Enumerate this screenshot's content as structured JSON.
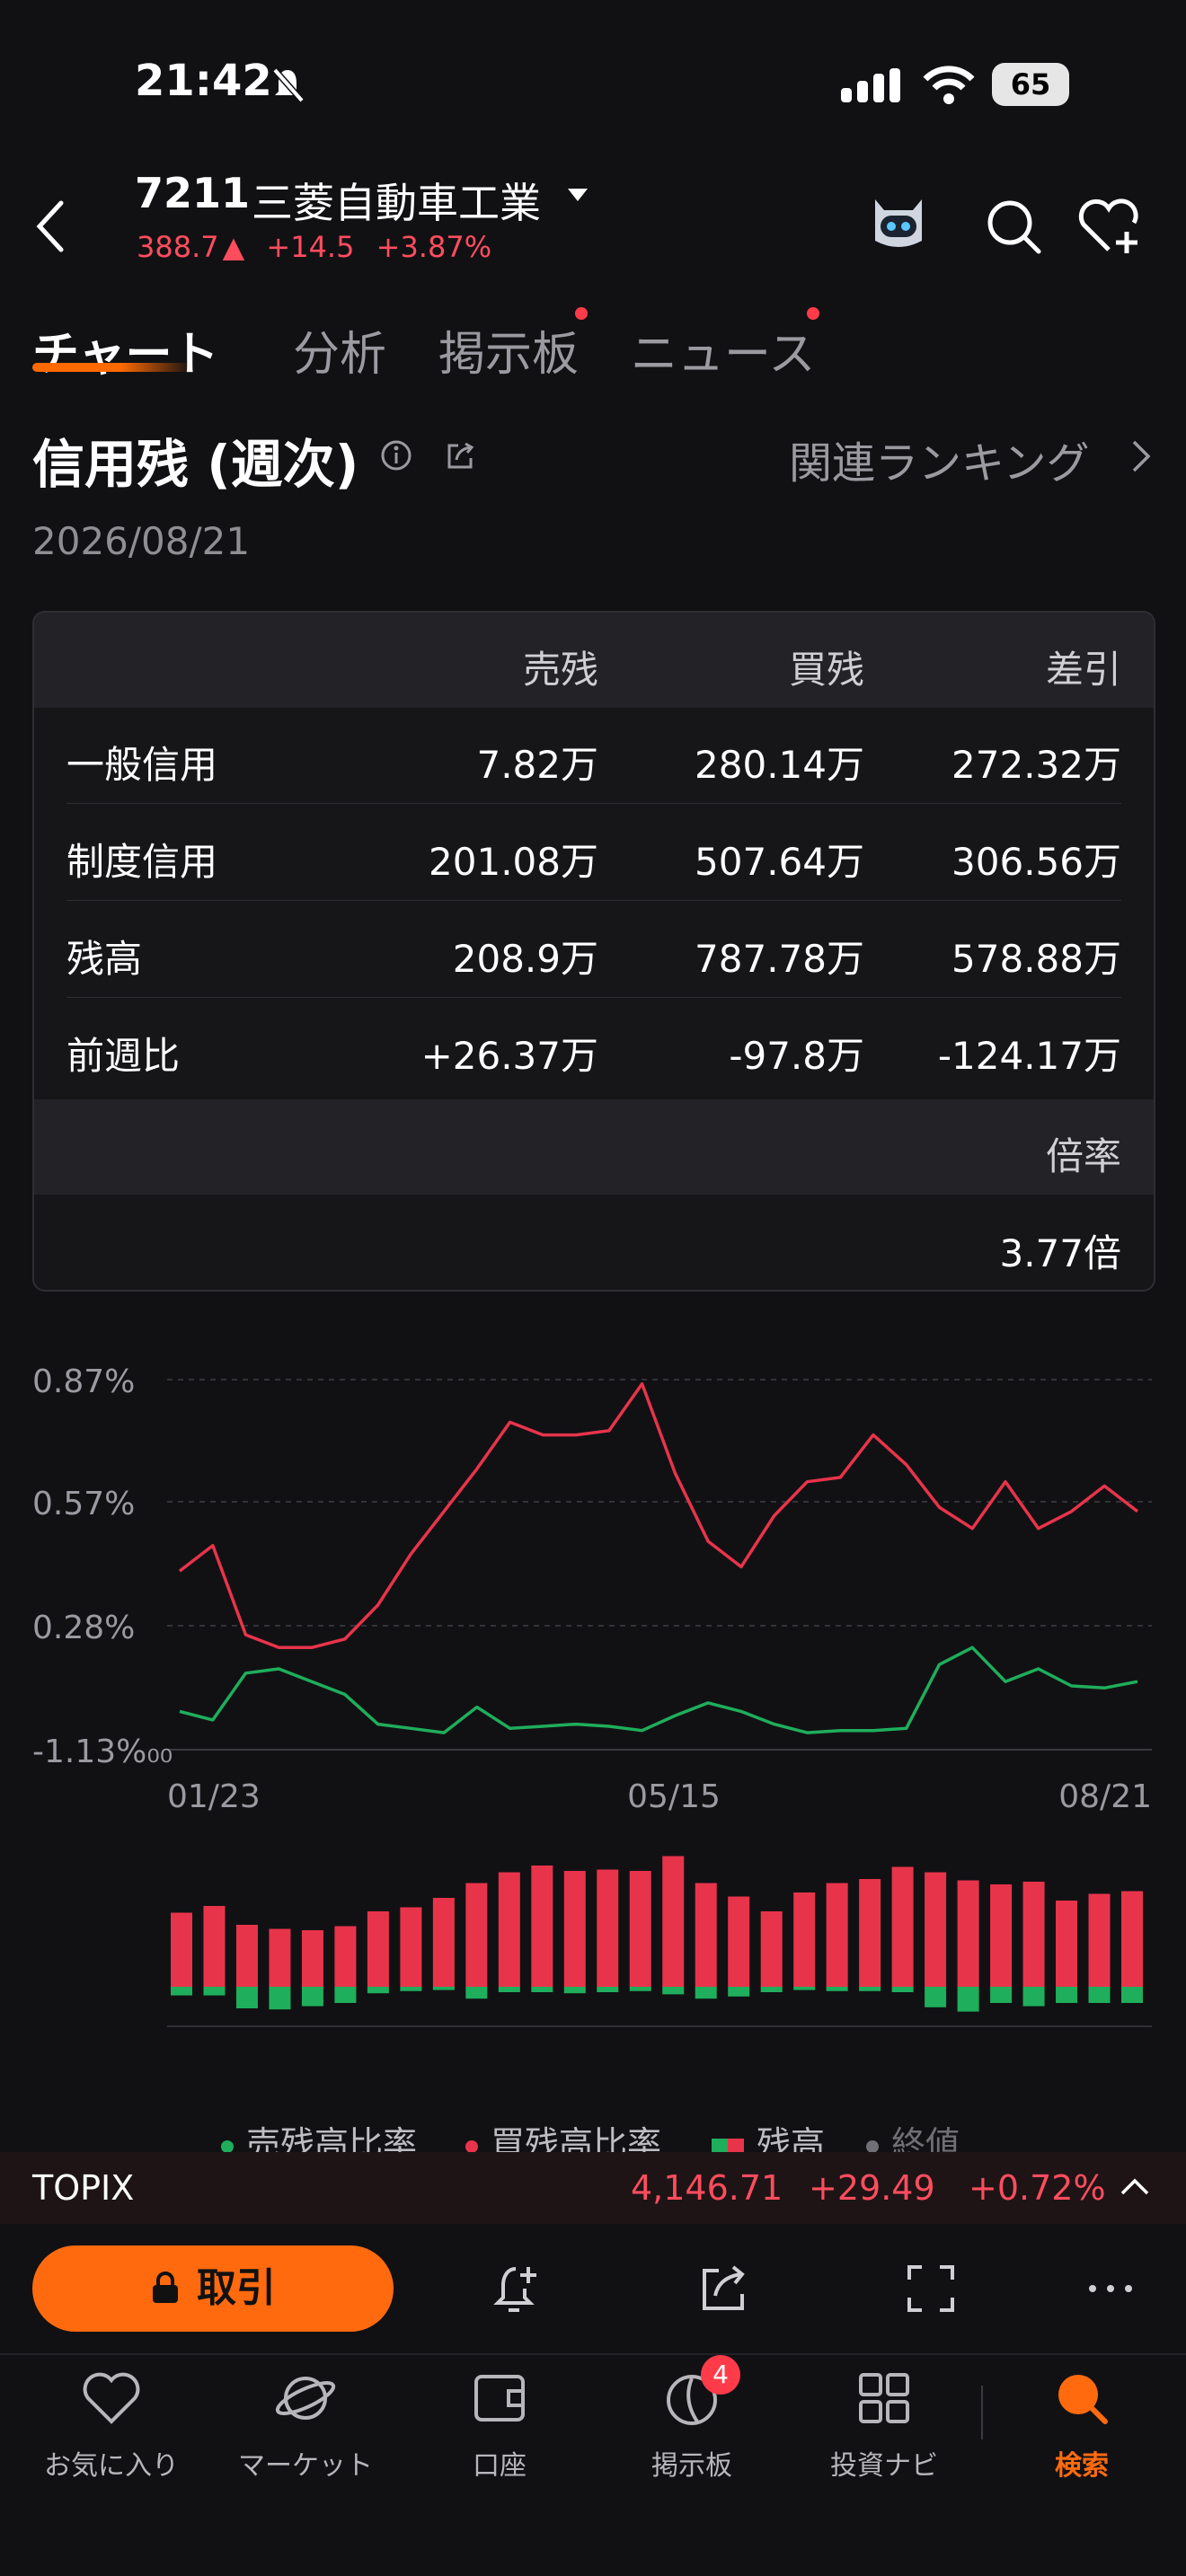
{
  "status": {
    "time": "21:42",
    "battery": "65"
  },
  "header": {
    "code": "7211",
    "name": "三菱自動車工業",
    "price": "388.7",
    "change": "+14.5",
    "change_pct": "+3.87%"
  },
  "tabs": [
    {
      "label": "チャート",
      "active": true
    },
    {
      "label": "分析"
    },
    {
      "label": "掲示板",
      "dot": true
    },
    {
      "label": "ニュース",
      "dot": true
    }
  ],
  "section": {
    "title": "信用残 (週次)",
    "ranking_link": "関連ランキング",
    "date": "2026/08/21"
  },
  "table": {
    "headers": [
      "売残",
      "買残",
      "差引"
    ],
    "rows": [
      {
        "label": "一般信用",
        "sell": "7.82万",
        "buy": "280.14万",
        "diff": "272.32万"
      },
      {
        "label": "制度信用",
        "sell": "201.08万",
        "buy": "507.64万",
        "diff": "306.56万"
      },
      {
        "label": "残高",
        "sell": "208.9万",
        "buy": "787.78万",
        "diff": "578.88万"
      },
      {
        "label": "前週比",
        "sell": "+26.37万",
        "buy": "-97.8万",
        "diff": "-124.17万"
      }
    ],
    "ratio_header": "倍率",
    "ratio_value": "3.77倍"
  },
  "chart_data": {
    "type": "line",
    "y_tick_labels": [
      "0.87%",
      "0.57%",
      "0.28%",
      "-1.13%₀₀"
    ],
    "x_tick_labels": [
      "01/23",
      "05/15",
      "08/21"
    ],
    "series": [
      {
        "name": "買残高比率",
        "color": "#e8344a",
        "values": [
          0.42,
          0.48,
          0.27,
          0.24,
          0.24,
          0.26,
          0.34,
          0.46,
          0.56,
          0.66,
          0.77,
          0.74,
          0.74,
          0.75,
          0.86,
          0.65,
          0.49,
          0.43,
          0.55,
          0.63,
          0.64,
          0.74,
          0.67,
          0.57,
          0.52,
          0.63,
          0.52,
          0.56,
          0.62,
          0.56
        ]
      },
      {
        "name": "売残高比率",
        "color": "#1fae5b",
        "values": [
          0.09,
          0.07,
          0.18,
          0.19,
          0.16,
          0.13,
          0.06,
          0.05,
          0.04,
          0.1,
          0.05,
          0.055,
          0.06,
          0.055,
          0.045,
          0.08,
          0.11,
          0.09,
          0.06,
          0.04,
          0.045,
          0.045,
          0.05,
          0.2,
          0.24,
          0.16,
          0.19,
          0.15,
          0.145,
          0.16
        ]
      }
    ],
    "bars": {
      "buy": [
        0.55,
        0.6,
        0.46,
        0.43,
        0.42,
        0.45,
        0.56,
        0.59,
        0.66,
        0.77,
        0.85,
        0.9,
        0.86,
        0.87,
        0.86,
        0.97,
        0.77,
        0.67,
        0.56,
        0.7,
        0.77,
        0.8,
        0.89,
        0.85,
        0.79,
        0.76,
        0.78,
        0.64,
        0.69,
        0.71
      ],
      "sell": [
        0.08,
        0.08,
        0.2,
        0.21,
        0.18,
        0.15,
        0.06,
        0.04,
        0.03,
        0.11,
        0.05,
        0.05,
        0.06,
        0.05,
        0.04,
        0.07,
        0.11,
        0.09,
        0.05,
        0.03,
        0.04,
        0.04,
        0.05,
        0.19,
        0.23,
        0.15,
        0.18,
        0.15,
        0.15,
        0.15
      ]
    },
    "legend": [
      {
        "label": "売残高比率",
        "color": "#1fae5b"
      },
      {
        "label": "買残高比率",
        "color": "#e8344a"
      },
      {
        "label": "残高",
        "color": "#e8344a"
      },
      {
        "label": "終値",
        "color": "#8e8e93"
      }
    ]
  },
  "topix": {
    "label": "TOPIX",
    "value": "4,146.71",
    "change": "+29.49",
    "change_pct": "+0.72%"
  },
  "actions": {
    "trade": "取引"
  },
  "nav": [
    {
      "label": "お気に入り",
      "icon": "heart-icon"
    },
    {
      "label": "マーケット",
      "icon": "planet-icon"
    },
    {
      "label": "口座",
      "icon": "wallet-icon"
    },
    {
      "label": "掲示板",
      "icon": "board-icon",
      "badge": "4"
    },
    {
      "label": "投資ナビ",
      "icon": "grid-icon"
    },
    {
      "label": "検索",
      "icon": "search-icon",
      "active": true
    }
  ]
}
